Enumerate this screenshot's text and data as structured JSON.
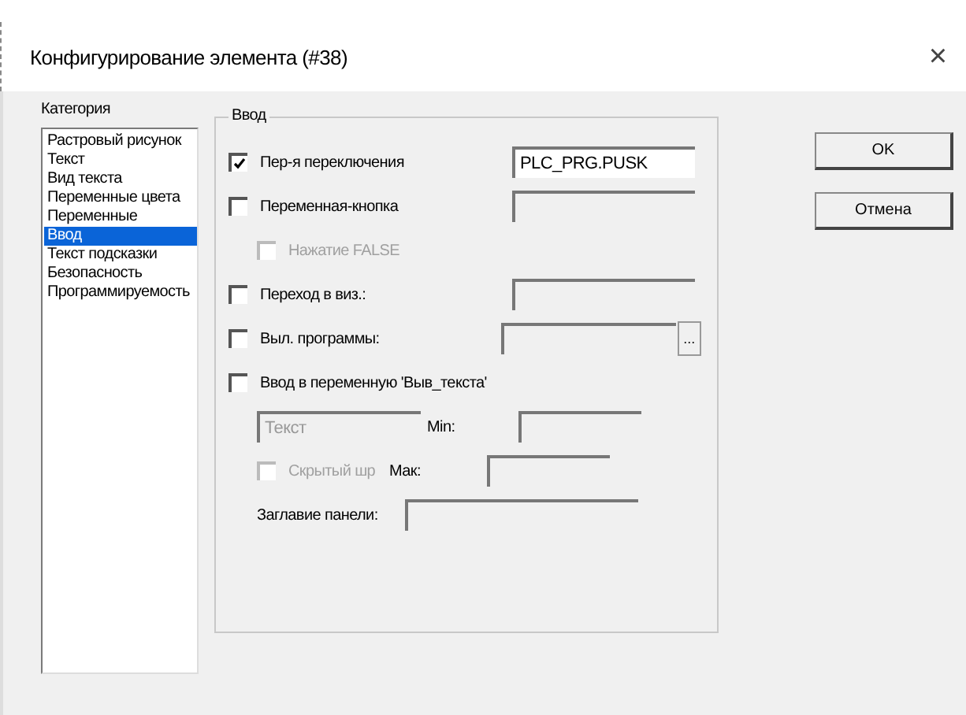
{
  "window": {
    "title": "Конфигурирование элемента (#38)",
    "close": "×"
  },
  "category": {
    "label": "Категория",
    "items": [
      {
        "label": "Растровый рисунок",
        "selected": false
      },
      {
        "label": "Текст",
        "selected": false
      },
      {
        "label": "Вид текста",
        "selected": false
      },
      {
        "label": "Переменные цвета",
        "selected": false
      },
      {
        "label": "Переменные",
        "selected": false
      },
      {
        "label": "Ввод",
        "selected": true
      },
      {
        "label": "Текст подсказки",
        "selected": false
      },
      {
        "label": "Безопасность",
        "selected": false
      },
      {
        "label": "Программируемость",
        "selected": false
      }
    ]
  },
  "group": {
    "title": "Ввод",
    "options": [
      {
        "kind": "field",
        "label": "Пер-я переключения",
        "checked": true,
        "disabled": false,
        "value": "PLC_PRG.PUSK"
      },
      {
        "kind": "field",
        "label": "Переменная-кнопка",
        "checked": false,
        "disabled": false
      },
      {
        "kind": "sub",
        "label": "Нажатие FALSE",
        "checked": false,
        "disabled": true
      },
      {
        "kind": "field",
        "label": "Переход в виз.:",
        "checked": false,
        "disabled": false
      },
      {
        "kind": "browse",
        "label": "Выл. программы:",
        "checked": false,
        "disabled": false,
        "button": "..."
      },
      {
        "kind": "check",
        "label": "Ввод в переменную 'Выв_текста'",
        "checked": false,
        "disabled": false
      }
    ],
    "text_field": {
      "value": "Текст",
      "disabled": true
    },
    "min_label": "Min:",
    "hidden": {
      "label": "Скрытый шр",
      "checked": false,
      "disabled": true
    },
    "max_label": "Мак:",
    "panel_title_label": "Заглавие панели:"
  },
  "buttons": [
    "OK",
    "Отмена"
  ]
}
